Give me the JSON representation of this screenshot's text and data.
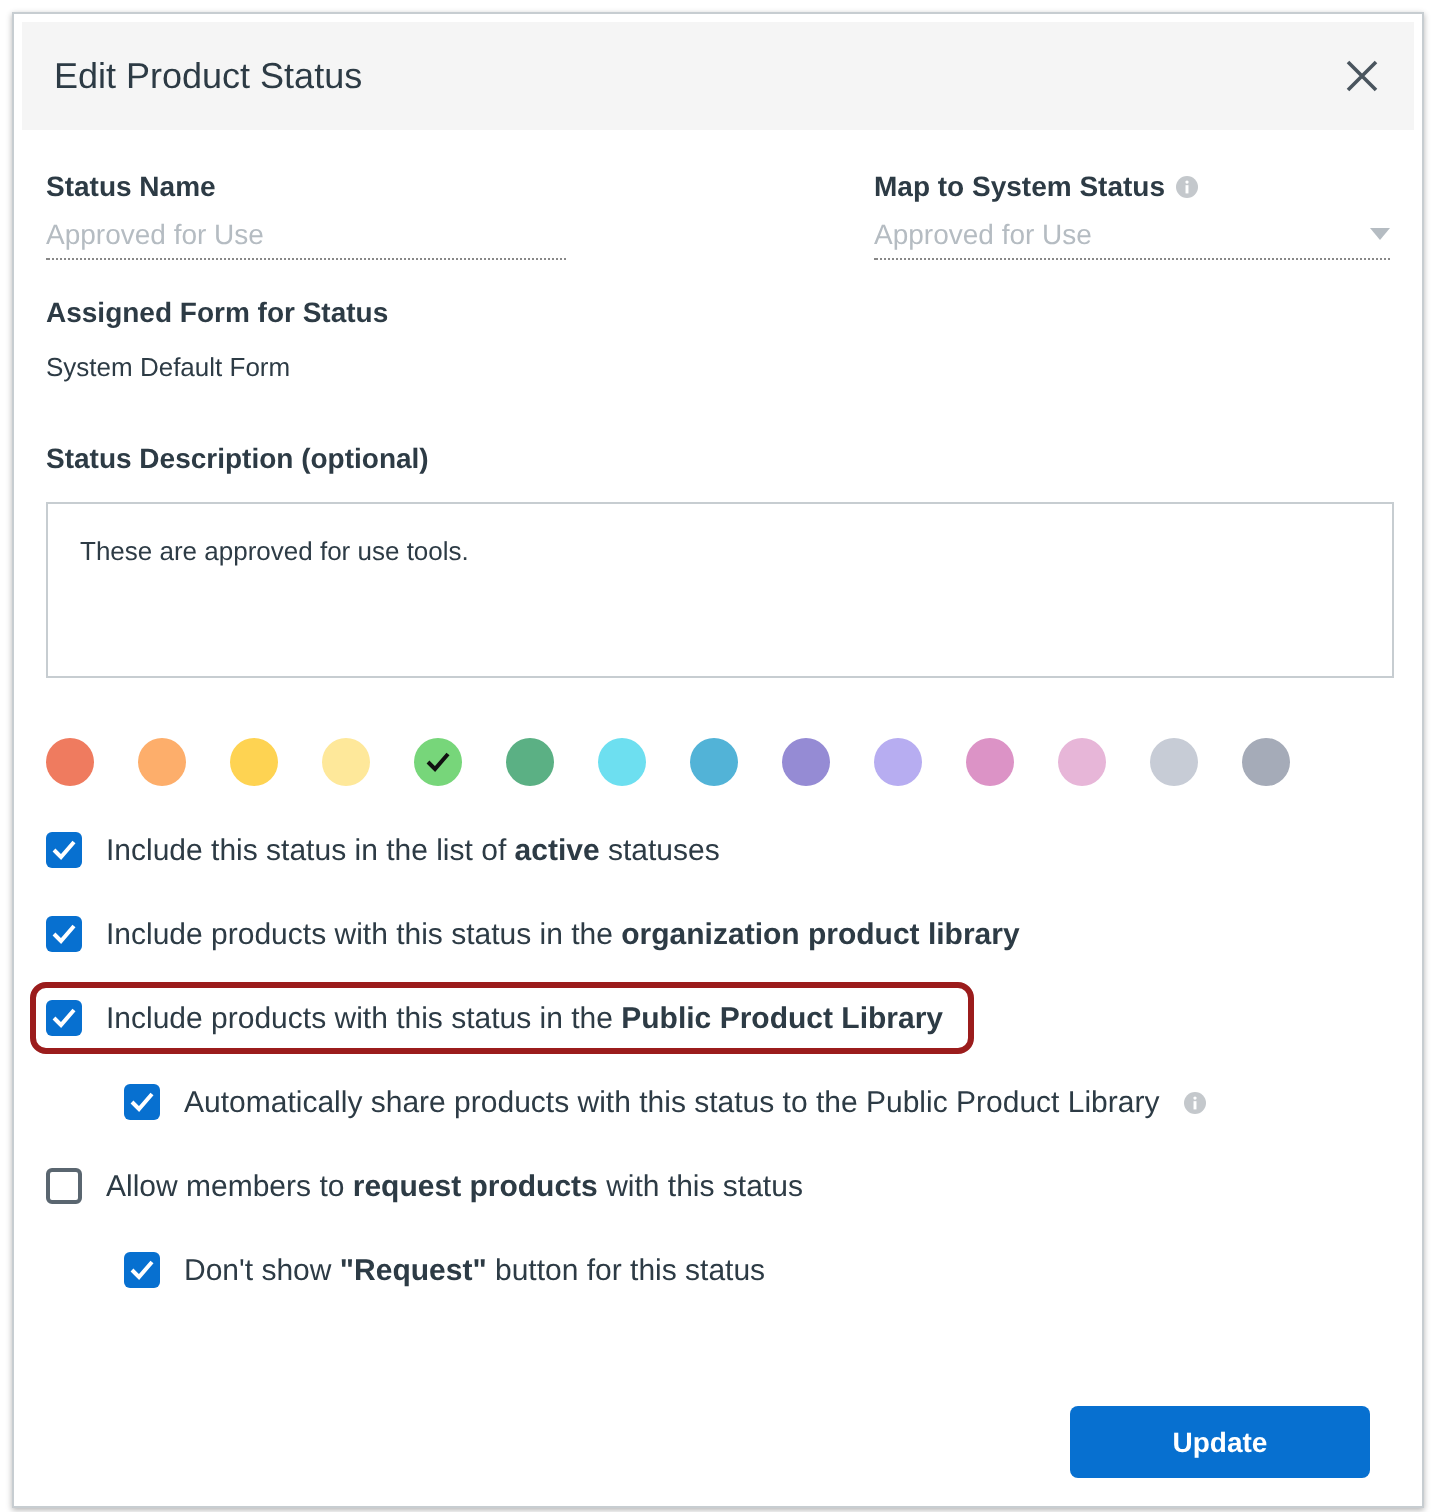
{
  "dialog": {
    "title": "Edit Product Status"
  },
  "status_name": {
    "label": "Status Name",
    "placeholder": "Approved for Use"
  },
  "system_status": {
    "label": "Map to System Status",
    "value": "Approved for Use"
  },
  "assigned_form": {
    "label": "Assigned Form for Status",
    "value": "System Default Form"
  },
  "description": {
    "label": "Status Description (optional)",
    "value": "These are approved for use tools."
  },
  "colors": [
    {
      "color": "#ef7b5f",
      "selected": false
    },
    {
      "color": "#fdae6b",
      "selected": false
    },
    {
      "color": "#fed352",
      "selected": false
    },
    {
      "color": "#fee89a",
      "selected": false
    },
    {
      "color": "#77d67a",
      "selected": true
    },
    {
      "color": "#5bb084",
      "selected": false
    },
    {
      "color": "#6ddff0",
      "selected": false
    },
    {
      "color": "#52b3d7",
      "selected": false
    },
    {
      "color": "#958bd4",
      "selected": false
    },
    {
      "color": "#b7adf1",
      "selected": false
    },
    {
      "color": "#dc93c6",
      "selected": false
    },
    {
      "color": "#e7b6d8",
      "selected": false
    },
    {
      "color": "#c7ccd6",
      "selected": false
    },
    {
      "color": "#a5abb8",
      "selected": false
    }
  ],
  "options": [
    {
      "label": "Include this status in the list of **active** statuses",
      "checked": true,
      "highlighted": false,
      "info": false
    },
    {
      "label": "Include products with this status in the **organization product library**",
      "checked": true,
      "highlighted": false,
      "info": false
    },
    {
      "label": "Include products with this status in the **Public Product Library**",
      "checked": true,
      "highlighted": true,
      "info": false,
      "children": [
        {
          "label": "Automatically share products with this status to the Public Product Library",
          "checked": true,
          "highlighted": false,
          "info": true
        }
      ]
    },
    {
      "label": "Allow members to **request products** with this status",
      "checked": false,
      "highlighted": false,
      "info": false,
      "children": [
        {
          "label": "Don't show **\"Request\"** button for this status",
          "checked": true,
          "highlighted": false,
          "info": false
        }
      ]
    }
  ],
  "buttons": [
    {
      "label": "Update"
    }
  ]
}
